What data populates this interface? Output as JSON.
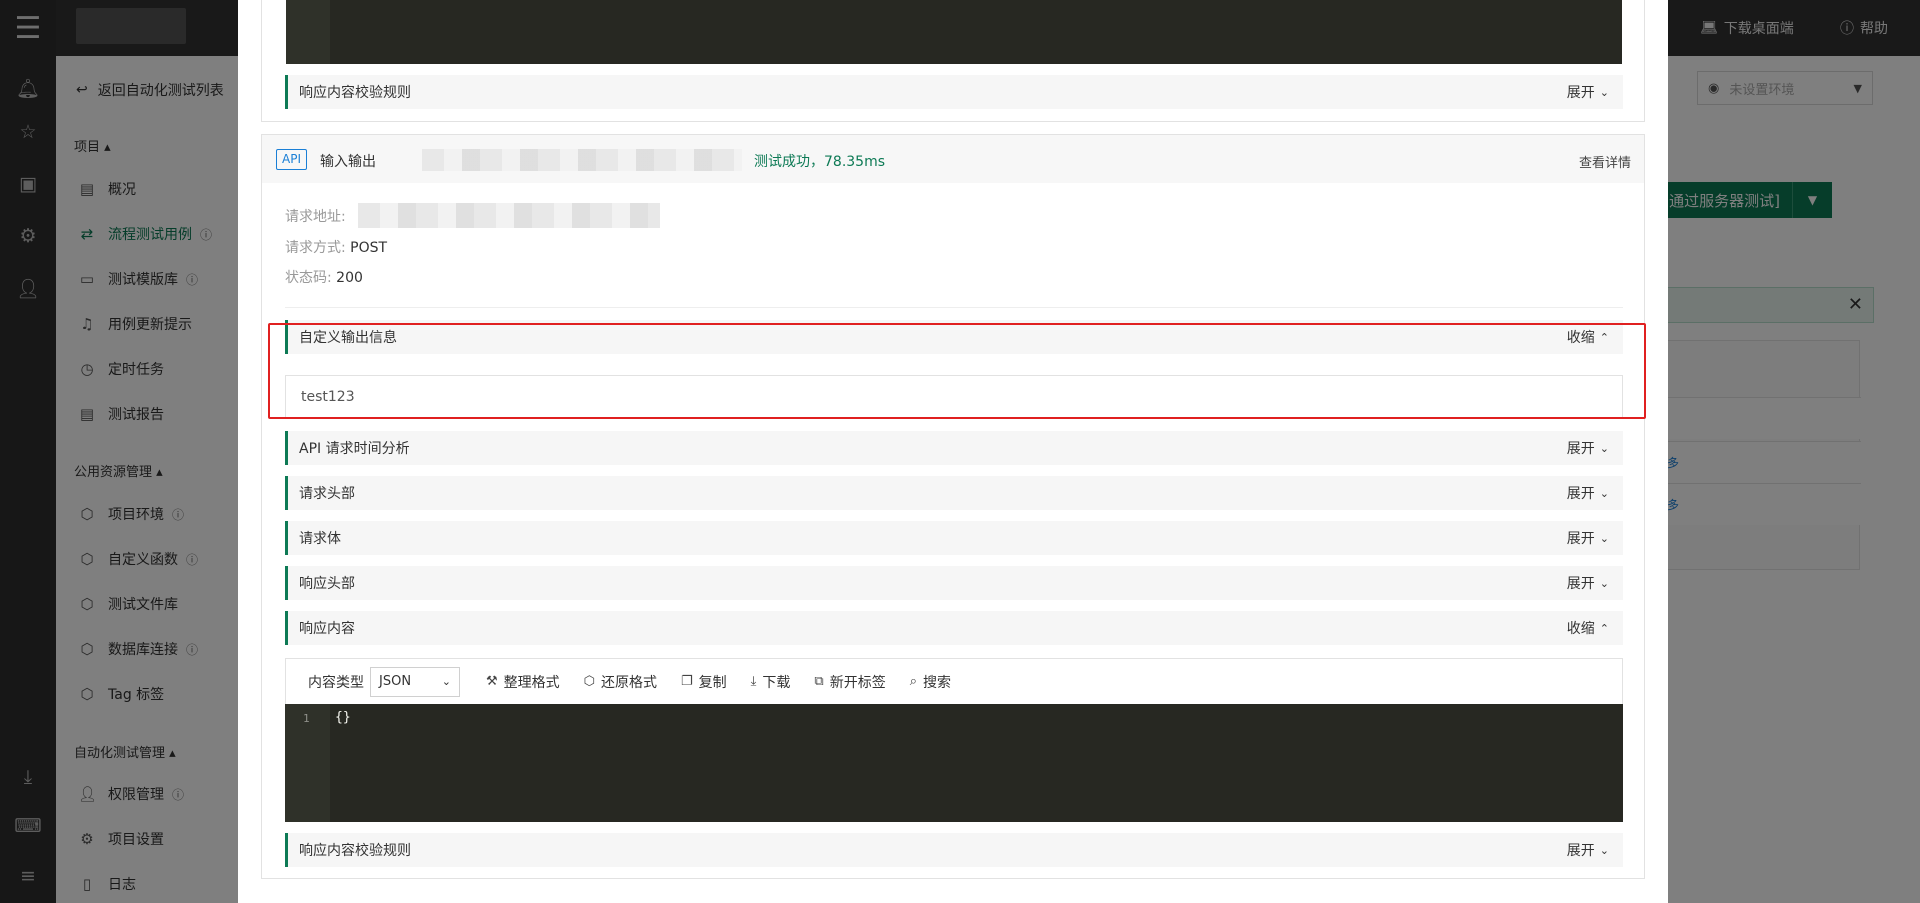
{
  "topbar": {
    "download_label": "下载桌面端",
    "help_label": "帮助"
  },
  "sidebar": {
    "back_label": "返回自动化测试列表",
    "group_project": "项目 ▴",
    "items_project": [
      "概况",
      "流程测试用例",
      "测试模版库",
      "用例更新提示",
      "定时任务",
      "测试报告"
    ],
    "group_public": "公用资源管理 ▴",
    "items_public": [
      "项目环境",
      "自定义函数",
      "测试文件库",
      "数据库连接",
      "Tag 标签"
    ],
    "group_auto": "自动化测试管理 ▴",
    "items_auto": [
      "权限管理",
      "项目设置",
      "日志"
    ]
  },
  "main": {
    "env_placeholder": "未设置环境",
    "run_label": "测试 [通过服务器测试]",
    "table_link": "多"
  },
  "modal": {
    "top_rule_label": "响应内容校验规则",
    "expand": "展开",
    "collapse": "收缩",
    "api_tag": "API",
    "io_label": "输入输出",
    "status_text": "测试成功，78.35ms",
    "detail_link": "查看详情",
    "req_url_label": "请求地址:",
    "req_method_label": "请求方式:",
    "req_method_value": "POST",
    "status_code_label": "状态码:",
    "status_code_value": "200",
    "custom_output_label": "自定义输出信息",
    "custom_output_value": "test123",
    "sections": [
      "API 请求时间分析",
      "请求头部",
      "请求体",
      "响应头部"
    ],
    "response_content_label": "响应内容",
    "content_type_label": "内容类型",
    "content_type_value": "JSON",
    "actions": [
      "整理格式",
      "还原格式",
      "复制",
      "下载",
      "新开标签",
      "搜索"
    ],
    "line_number": "1",
    "code": "{}",
    "bottom_rule_label": "响应内容校验规则"
  },
  "colors": {
    "accent": "#0d7a55",
    "highlight": "#e02020",
    "link": "#1a7fd6",
    "editor_bg": "#272822"
  }
}
